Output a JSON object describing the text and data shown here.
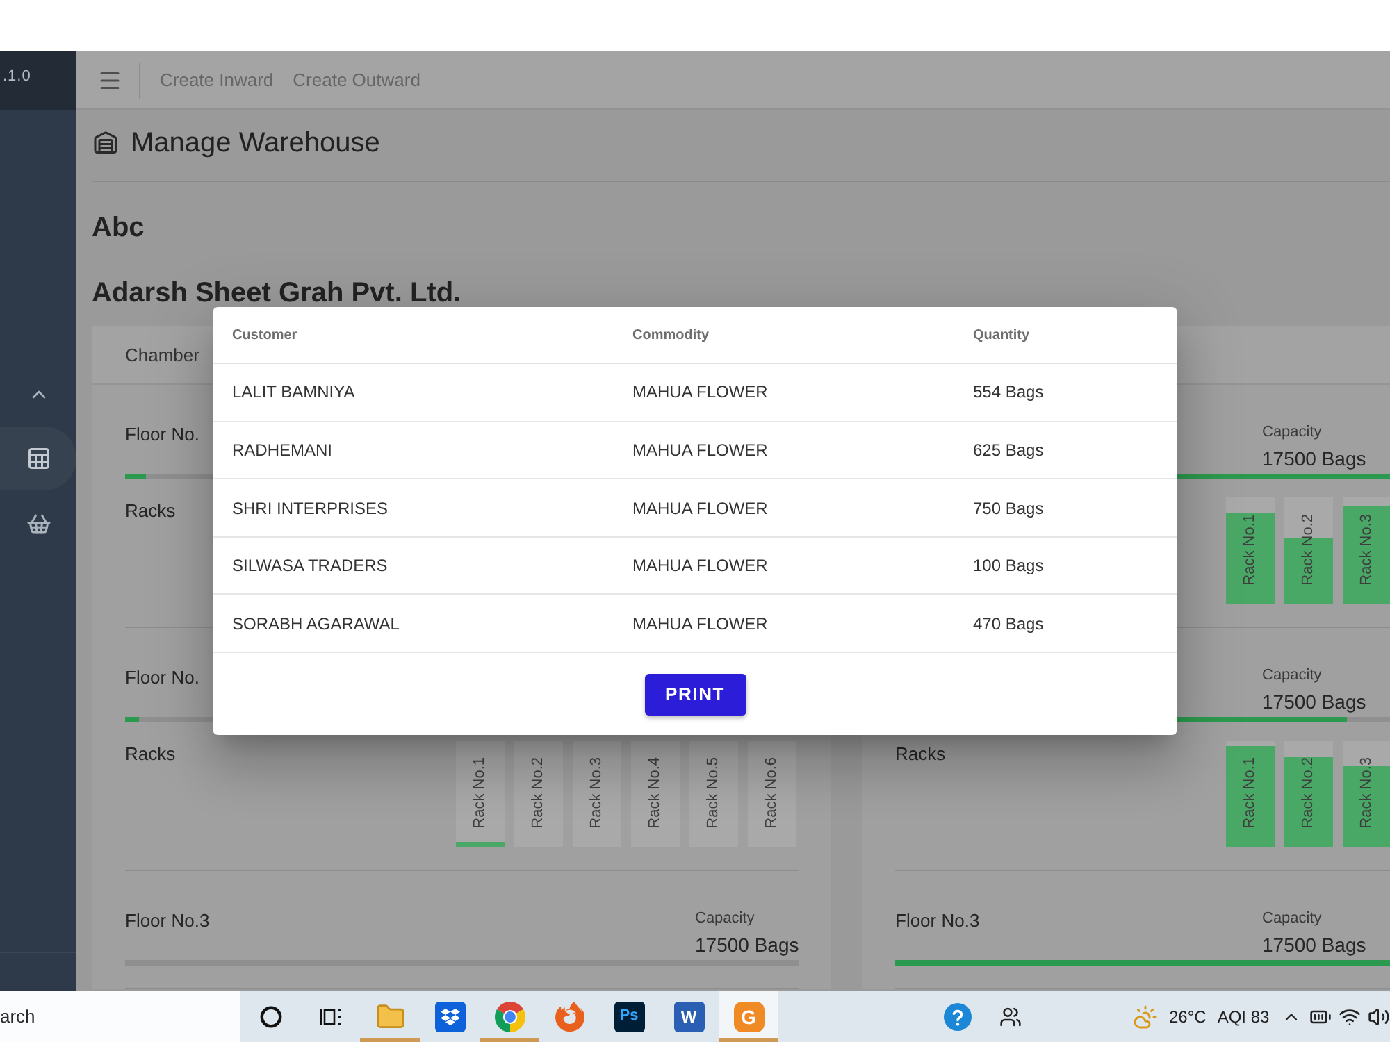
{
  "sidebar": {
    "version": ".1.0",
    "group_expanded": true,
    "items": [
      {
        "selected": true
      },
      {
        "selected": false
      }
    ]
  },
  "header": {
    "links": [
      "Create Inward",
      "Create Outward"
    ]
  },
  "page": {
    "title": "Manage Warehouse",
    "warehouse": "Abc",
    "company": "Adarsh Sheet Grah Pvt. Ltd."
  },
  "chamber": {
    "heading": "Chamber",
    "columns": [
      {
        "floors": [
          {
            "title": "Floor No.",
            "level": 0.03,
            "racks_label": "Racks"
          },
          {
            "title": "Floor No.",
            "level": 0.02,
            "racks_label": "Racks",
            "racks": [
              {
                "label": "Rack No.1",
                "level": 0.05
              },
              {
                "label": "Rack No.2"
              },
              {
                "label": "Rack No.3"
              },
              {
                "label": "Rack No.4"
              },
              {
                "label": "Rack No.5"
              },
              {
                "label": "Rack No.6"
              }
            ]
          },
          {
            "title": "Floor No.3",
            "capacity_label": "Capacity",
            "capacity": "17500 Bags"
          }
        ]
      },
      {
        "floors": [
          {
            "capacity_label": "Capacity",
            "capacity": "17500 Bags",
            "level": 1,
            "racks": [
              {
                "label": "Rack No.1",
                "level": 0.86
              },
              {
                "label": "Rack No.2",
                "level": 0.62
              },
              {
                "label": "Rack No.3",
                "level": 0.92
              }
            ]
          },
          {
            "capacity_label": "Capacity",
            "capacity": "17500 Bags",
            "level": 0.67,
            "racks_label": "Racks",
            "racks": [
              {
                "label": "Rack No.1",
                "level": 0.95
              },
              {
                "label": "Rack No.2",
                "level": 0.84
              },
              {
                "label": "Rack No.3",
                "level": 0.76
              }
            ]
          },
          {
            "title": "Floor No.3",
            "capacity_label": "Capacity",
            "capacity": "17500 Bags",
            "level": 1
          }
        ]
      }
    ]
  },
  "dialog": {
    "columns": [
      "Customer",
      "Commodity",
      "Quantity"
    ],
    "rows": [
      {
        "customer": "LALIT BAMNIYA",
        "commodity": "MAHUA FLOWER",
        "quantity": "554 Bags"
      },
      {
        "customer": "RADHEMANI",
        "commodity": "MAHUA FLOWER",
        "quantity": "625 Bags"
      },
      {
        "customer": "SHRI INTERPRISES",
        "commodity": "MAHUA FLOWER",
        "quantity": "750 Bags"
      },
      {
        "customer": "SILWASA TRADERS",
        "commodity": "MAHUA FLOWER",
        "quantity": "100 Bags"
      },
      {
        "customer": "SORABH AGARAWAL",
        "commodity": "MAHUA FLOWER",
        "quantity": "470 Bags"
      }
    ],
    "button": "PRINT"
  },
  "taskbar": {
    "search": {
      "placeholder": "arch"
    },
    "apps": [
      {
        "running": true,
        "active": false
      },
      {
        "running": false,
        "active": false
      },
      {
        "running": true,
        "active": false
      },
      {
        "running": false,
        "active": false
      },
      {
        "logo": "Ps",
        "running": false,
        "active": false
      },
      {
        "logo": "W",
        "running": false,
        "active": false
      },
      {
        "logo": "G",
        "running": true,
        "active": true
      }
    ],
    "weather": {
      "temperature": "26°C",
      "aqi": "AQI 83"
    }
  }
}
